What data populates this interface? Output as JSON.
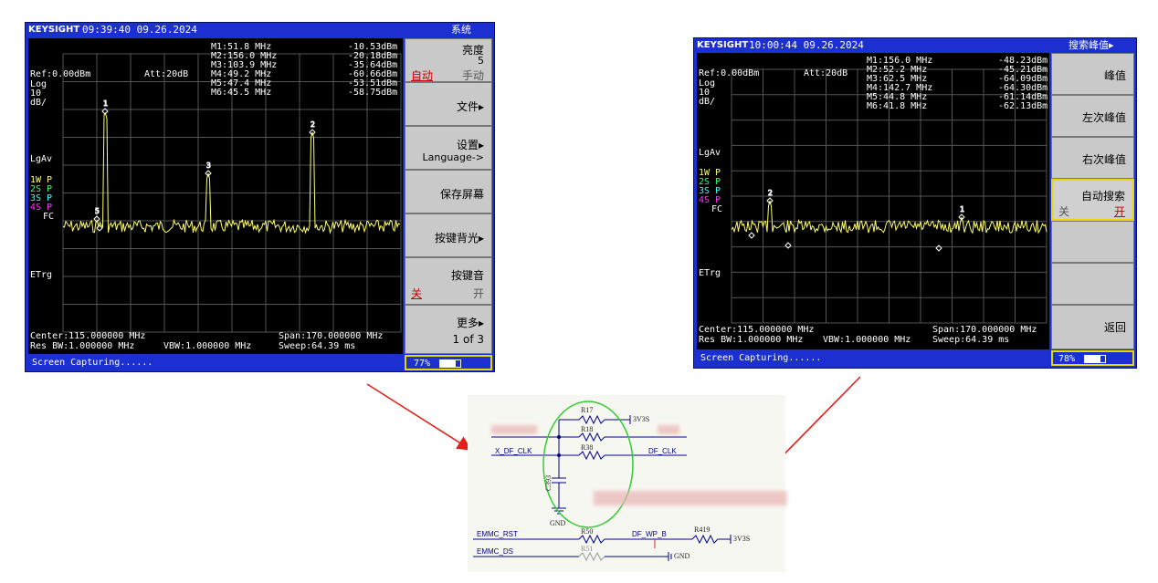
{
  "left": {
    "logo": "KEYSIGHT",
    "datetime": "09:39:40  09.26.2024",
    "menu_title": "系统",
    "ref": "Ref:0.00dBm",
    "att": "Att:20dB",
    "scale": [
      "Log",
      "10",
      "dB/"
    ],
    "markers": [
      {
        "name": "M1:51.8 MHz",
        "level": "-10.53dBm"
      },
      {
        "name": "M2:156.0 MHz",
        "level": "-20.18dBm"
      },
      {
        "name": "M3:103.9 MHz",
        "level": "-35.64dBm"
      },
      {
        "name": "M4:49.2 MHz",
        "level": "-60.66dBm"
      },
      {
        "name": "M5:47.4 MHz",
        "level": "-53.51dBm"
      },
      {
        "name": "M6:45.5 MHz",
        "level": "-58.75dBm"
      }
    ],
    "lgav": "LgAv",
    "traces": [
      "1W P",
      "2S P",
      "3S P",
      "4S P"
    ],
    "fc": "FC",
    "etrg": "ETrg",
    "center": "Center:115.000000 MHz",
    "span": "Span:170.000000 MHz",
    "res_bw": "Res BW:1.000000 MHz",
    "vbw": "VBW:1.000000 MHz",
    "sweep": "Sweep:64.39 ms",
    "status": "Screen Capturing......",
    "battery": "77%",
    "softkeys": {
      "brightness": {
        "label": "亮度",
        "value": "5",
        "auto": "自动",
        "manual": "手动"
      },
      "file": "文件▸",
      "settings": "设置▸",
      "language": "Language->",
      "save_screen": "保存屏幕",
      "key_backlight": "按键背光▸",
      "key_sound": {
        "label": "按键音",
        "off": "关",
        "on": "开"
      },
      "more": "更多▸",
      "page": "1 of 3"
    }
  },
  "right": {
    "logo": "KEYSIGHT",
    "datetime": "10:00:44  09.26.2024",
    "menu_title": "搜索峰值▸",
    "ref": "Ref:0.00dBm",
    "att": "Att:20dB",
    "scale": [
      "Log",
      "10",
      "dB/"
    ],
    "markers": [
      {
        "name": "M1:156.0 MHz",
        "level": "-48.23dBm"
      },
      {
        "name": "M2:52.2 MHz",
        "level": "-45.21dBm"
      },
      {
        "name": "M3:62.5 MHz",
        "level": "-64.09dBm"
      },
      {
        "name": "M4:142.7 MHz",
        "level": "-64.30dBm"
      },
      {
        "name": "M5:44.8 MHz",
        "level": "-61.14dBm"
      },
      {
        "name": "M6:41.8 MHz",
        "level": "-62.13dBm"
      }
    ],
    "lgav": "LgAv",
    "traces": [
      "1W P",
      "2S P",
      "3S P",
      "4S P"
    ],
    "fc": "FC",
    "etrg": "ETrg",
    "center": "Center:115.000000 MHz",
    "span": "Span:170.000000 MHz",
    "res_bw": "Res BW:1.000000 MHz",
    "vbw": "VBW:1.000000 MHz",
    "sweep": "Sweep:64.39 ms",
    "status": "Screen Capturing......",
    "battery": "78%",
    "softkeys": {
      "peak": "峰值",
      "next_left": "左次峰值",
      "next_right": "右次峰值",
      "auto_search": {
        "label": "自动搜索",
        "off": "关",
        "on": "开"
      },
      "back": "返回"
    }
  },
  "schematic": {
    "components": [
      "R17",
      "R18",
      "R38",
      "C393",
      "R50",
      "R51",
      "R419"
    ],
    "nets": [
      "3V3S",
      "X_DF_CLK",
      "DF_CLK",
      "GND",
      "EMMC_RST",
      "DF_WP_B",
      "3V3S",
      "EMMC_DS",
      "GND"
    ]
  },
  "colors": {
    "instrument_blue": "#1c2fd0",
    "trace_yellow": "#ffff66",
    "arrow_red": "#e0201a",
    "highlight_green": "#33cc33",
    "trace2": "#33ff66",
    "trace3": "#33ffff",
    "trace4": "#ff33ff"
  }
}
